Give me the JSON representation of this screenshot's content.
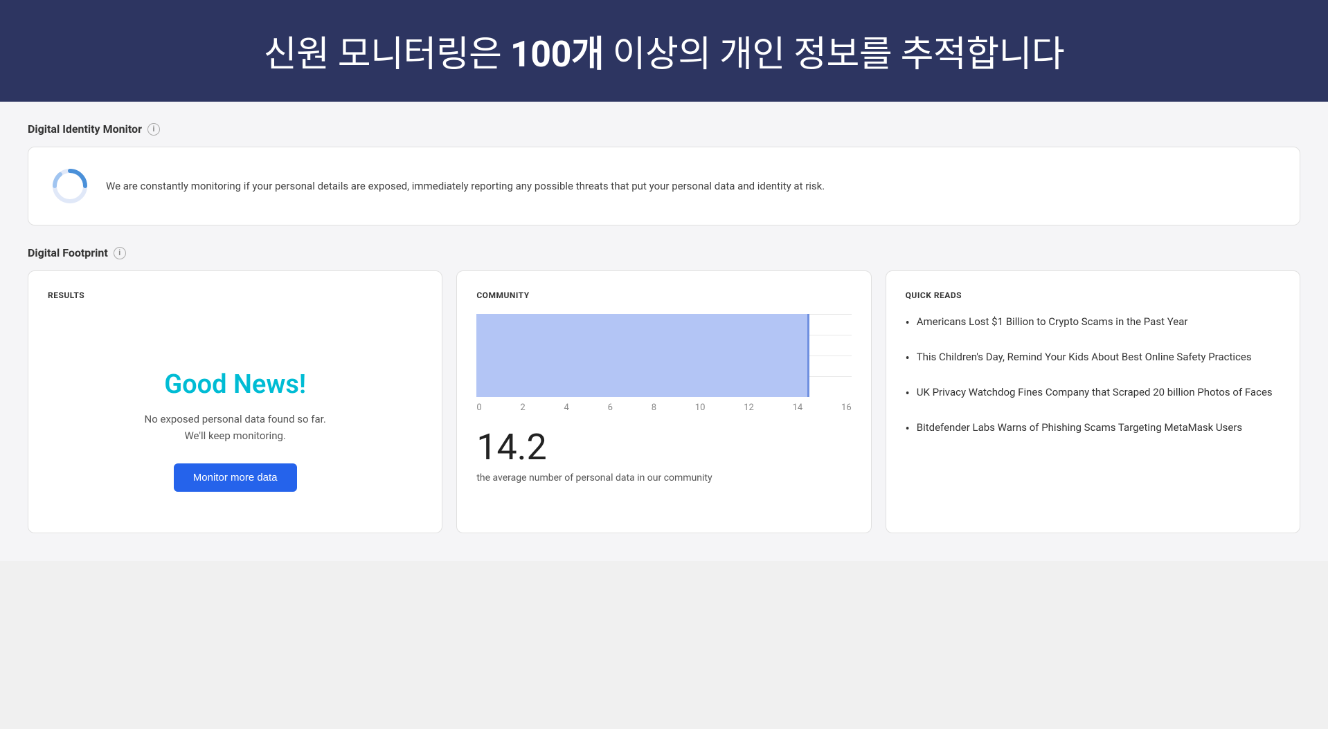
{
  "hero": {
    "text_part1": "신원 모니터링은 ",
    "text_bold": "100개",
    "text_part2": " 이상의 개인 정보를 추적합니다"
  },
  "digital_identity_monitor": {
    "section_title": "Digital Identity Monitor",
    "info_icon_label": "i",
    "monitor_text": "We are constantly monitoring if your personal details are exposed, immediately reporting any possible threats that put your personal data and identity at risk."
  },
  "digital_footprint": {
    "section_title": "Digital Footprint",
    "info_icon_label": "i"
  },
  "results_card": {
    "label": "RESULTS",
    "good_news": "Good News!",
    "no_data_text": "No exposed personal data found so far.\nWe'll keep monitoring.",
    "button_label": "Monitor more data"
  },
  "community_card": {
    "label": "COMMUNITY",
    "chart_x_labels": [
      "0",
      "2",
      "4",
      "6",
      "8",
      "10",
      "12",
      "14",
      "16"
    ],
    "bar_value": 14.2,
    "bar_max": 16,
    "community_value": "14.2",
    "community_desc": "the average number of personal data in our community"
  },
  "quick_reads_card": {
    "label": "QUICK READS",
    "items": [
      {
        "text": "Americans Lost $1 Billion to Crypto Scams in the Past Year"
      },
      {
        "text": "This Children's Day, Remind Your Kids About Best Online Safety Practices"
      },
      {
        "text": "UK Privacy Watchdog Fines Company that Scraped 20 billion Photos of Faces"
      },
      {
        "text": "Bitdefender Labs Warns of Phishing Scams Targeting MetaMask Users"
      }
    ]
  }
}
